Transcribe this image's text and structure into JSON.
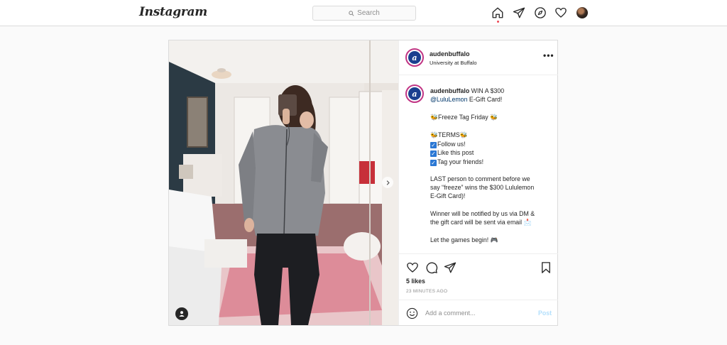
{
  "nav": {
    "logo": "Instagram",
    "search_placeholder": "Search",
    "icons": [
      "home-icon",
      "direct-icon",
      "explore-icon",
      "activity-icon",
      "profile-avatar"
    ]
  },
  "post": {
    "username": "audenbuffalo",
    "location": "University at Buffalo",
    "avatar_letter": "a",
    "more_label": "•••",
    "caption": {
      "username": "audenbuffalo",
      "line1": " WIN A $300",
      "mention": "@LuluLemon",
      "line2": " E-Gift Card!",
      "freeze": "Freeze Tag Friday",
      "terms": "TERMS",
      "term1": "Follow us!",
      "term2": "Like this post",
      "term3": "Tag your friends!",
      "para1a": "LAST person to comment before we",
      "para1b": "say “freeze” wins the $300 Lululemon",
      "para1c": "E-Gift Card)!",
      "para2a": "Winner will be notified by us via DM &",
      "para2b": "the gift card will be sent via email",
      "para3": "Let the games begin!"
    },
    "likes": "5 likes",
    "time": "23 MINUTES AGO",
    "comment_placeholder": "Add a comment...",
    "post_label": "Post"
  },
  "colors": {
    "accent": "#0095f6",
    "post_disabled": "#b2dffc",
    "story_ring": "#c13584",
    "avatar_bg": "#1b3f8f"
  }
}
